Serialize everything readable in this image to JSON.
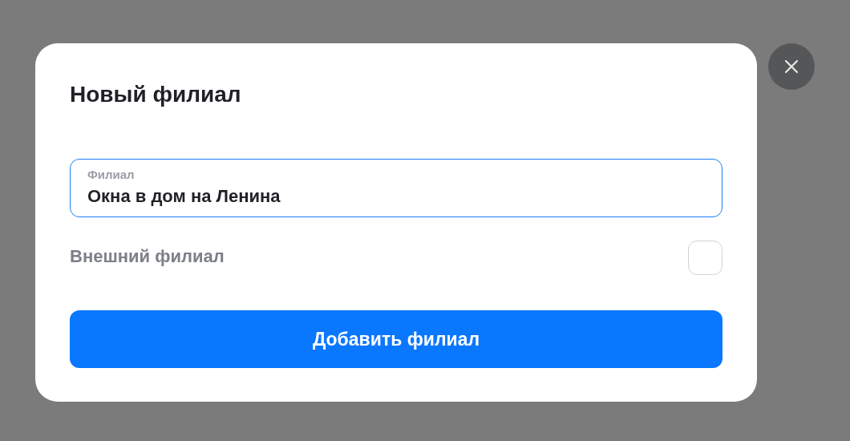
{
  "dialog": {
    "title": "Новый филиал",
    "field": {
      "label": "Филиал",
      "value": "Окна в дом на Ленина",
      "focused": true
    },
    "option": {
      "label": "Внешний филиал",
      "checked": false
    },
    "submit": "Добавить филиал"
  }
}
